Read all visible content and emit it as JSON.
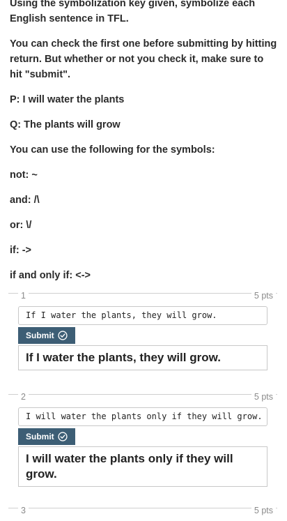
{
  "instructions": {
    "p1": "Using the symbolization key given, symbolize each English sentence in TFL.",
    "p2": "You can check the first one before submitting by hitting return. But whether or not you check it, make sure to hit \"submit\".",
    "key_p": "P: I will water the plants",
    "key_q": "Q: The plants will grow",
    "symbols_intro": "You can use the following for the symbols:",
    "not": "not: ~",
    "and": "and: /\\",
    "or": "or: \\/",
    "if": "if: ->",
    "iff": "if and only if: <->"
  },
  "questions": [
    {
      "number": "1",
      "points": "5 pts",
      "input_value": "If I water the plants, they will grow.",
      "submit_label": "Submit",
      "result": "If I water the plants, they will grow."
    },
    {
      "number": "2",
      "points": "5 pts",
      "input_value": "I will water the plants only if they will grow.",
      "submit_label": "Submit",
      "result": "I will water the plants only if they will grow."
    }
  ],
  "partial_question": {
    "number": "3",
    "points": "5 pts"
  },
  "colors": {
    "submit_bg": "#3d5e75",
    "border": "#c8c8c8"
  },
  "icons": {
    "submit": "check-circle-icon"
  }
}
